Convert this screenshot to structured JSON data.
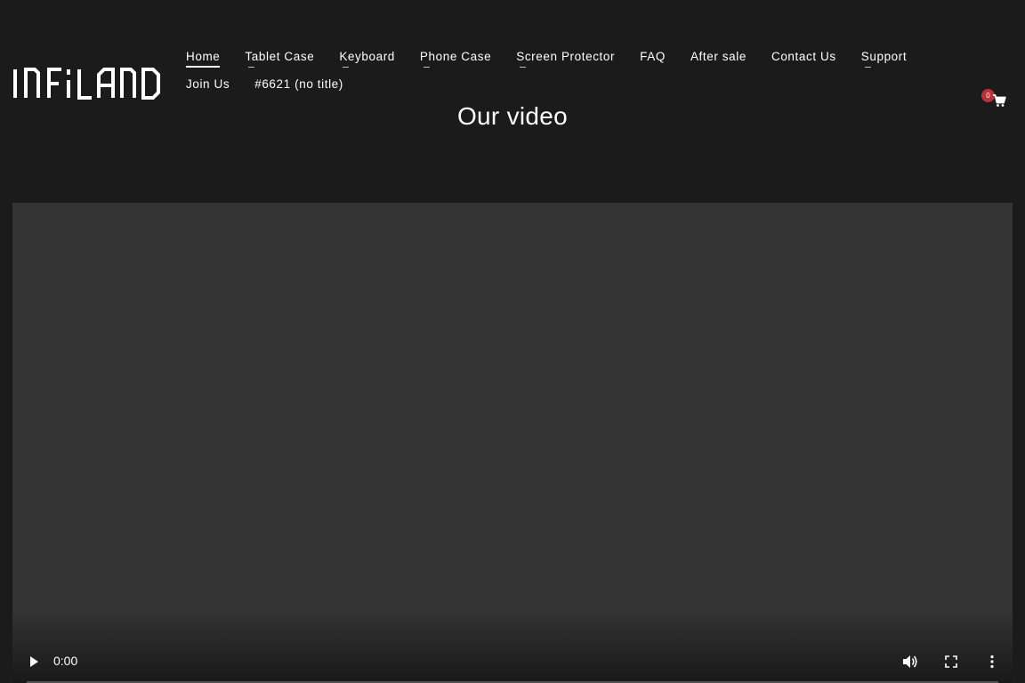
{
  "brand": {
    "logo_text": "INFiLAND"
  },
  "nav": {
    "items": [
      {
        "label": "Home",
        "active": true,
        "has_submenu": false
      },
      {
        "label": "Tablet Case",
        "active": false,
        "has_submenu": true
      },
      {
        "label": "Keyboard",
        "active": false,
        "has_submenu": true
      },
      {
        "label": "Phone Case",
        "active": false,
        "has_submenu": true
      },
      {
        "label": "Screen Protector",
        "active": false,
        "has_submenu": true
      },
      {
        "label": "FAQ",
        "active": false,
        "has_submenu": false
      },
      {
        "label": "After sale",
        "active": false,
        "has_submenu": false
      },
      {
        "label": "Contact Us",
        "active": false,
        "has_submenu": false
      },
      {
        "label": "Support",
        "active": false,
        "has_submenu": true
      },
      {
        "label": "Join Us",
        "active": false,
        "has_submenu": false
      },
      {
        "label": "#6621 (no title)",
        "active": false,
        "has_submenu": false
      }
    ]
  },
  "cart": {
    "count": "0",
    "icon": "cart-icon",
    "badge_color": "#b8323a"
  },
  "section": {
    "title": "Our video"
  },
  "video": {
    "current_time": "0:00",
    "progress": 0,
    "icons": [
      "play-icon",
      "volume-icon",
      "fullscreen-icon",
      "more-options-icon"
    ]
  },
  "colors": {
    "background": "#1b1b1b",
    "video_background": "#333333",
    "text": "#ffffff"
  }
}
